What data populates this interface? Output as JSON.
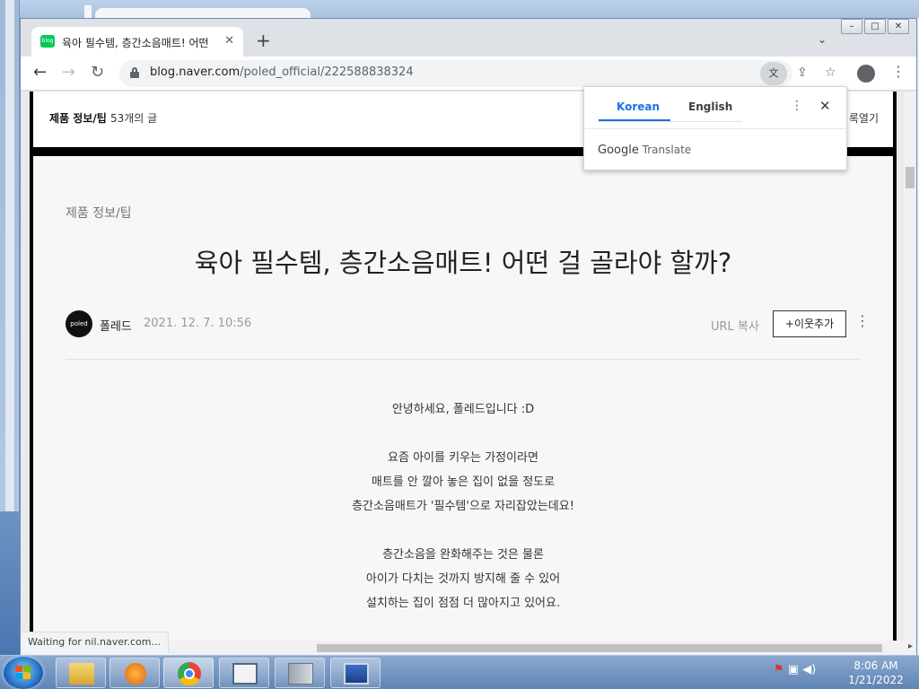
{
  "browser": {
    "tab_title": "육아 필수템, 층간소음매트! 어떤",
    "favicon_label": "blog",
    "new_tab_label": "+",
    "url_host": "blog.naver.com",
    "url_path": "/poled_official/222588838324",
    "tab_close": "✕",
    "tab_search": "⌄"
  },
  "window_controls": {
    "minimize": "–",
    "maximize": "□",
    "close": "✕"
  },
  "page": {
    "category_name": "제품 정보/팁",
    "category_count": "53개의 글",
    "list_open": "록열기",
    "post_category": "제품 정보/팁",
    "title": "육아 필수템, 층간소음매트! 어떤 걸 골라야 할까?",
    "avatar_text": "poled",
    "author": "폴레드",
    "date": "2021. 12. 7. 10:56",
    "url_copy": "URL 복사",
    "add_neighbor": "+이웃추가",
    "body": {
      "line1": "안녕하세요, 폴레드입니다 :D",
      "line2": "요즘 아이를 키우는 가정이라면",
      "line3": "매트를 안 깔아 놓은 집이 없을 정도로",
      "line4": "층간소음매트가 '필수템'으로 자리잡았는데요!",
      "line5": "층간소음을 완화해주는 것은 물론",
      "line6": "아이가 다치는 것까지 방지해 줄 수 있어",
      "line7": "설치하는 집이 점점 더 많아지고 있어요."
    }
  },
  "translate_popup": {
    "source_lang": "Korean",
    "target_lang": "English",
    "brand_google": "Google",
    "brand_translate": "Translate"
  },
  "status_text": "Waiting for nil.naver.com...",
  "taskbar": {
    "time": "8:06 AM",
    "date": "1/21/2022"
  },
  "colors": {
    "accent": "#1a73e8",
    "naver_green": "#03c75a"
  }
}
